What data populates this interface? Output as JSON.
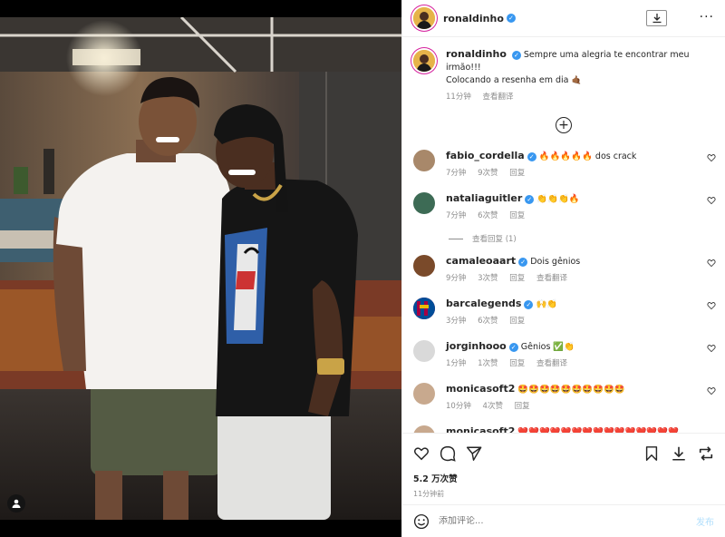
{
  "post": {
    "author": "ronaldinho",
    "caption_line1": "Sempre uma alegria te encontrar meu irmão!!!",
    "caption_line2": "Colocando a resenha em dia",
    "caption_emoji": "🤙🏾",
    "caption_time": "11分钟",
    "see_translation": "查看翻译",
    "likes": "5.2 万次赞",
    "time_ago": "11分钟前"
  },
  "comments": [
    {
      "user": "fabio_cordella",
      "text": "🔥🔥🔥🔥🔥 dos crack",
      "time": "7分钟",
      "likes": "9次赞",
      "reply": "回复",
      "translate": "",
      "avatar_color": "#a8886a"
    },
    {
      "user": "nataliaguitler",
      "text": "👏👏👏🔥",
      "time": "7分钟",
      "likes": "6次赞",
      "reply": "回复",
      "translate": "",
      "avatar_color": "#3d6b55",
      "view_replies": "查看回复 (1)"
    },
    {
      "user": "camaleoaart",
      "text": "Dois gênios",
      "time": "9分钟",
      "likes": "3次赞",
      "reply": "回复",
      "translate": "查看翻译",
      "avatar_color": "#7a4a2a"
    },
    {
      "user": "barcalegends",
      "text": "🙌👏",
      "time": "3分钟",
      "likes": "6次赞",
      "reply": "回复",
      "translate": "",
      "avatar_color": "#a50044"
    },
    {
      "user": "jorginhooo",
      "text": "Gênios ✅👏",
      "time": "1分钟",
      "likes": "1次赞",
      "reply": "回复",
      "translate": "查看翻译",
      "avatar_color": "#d9d9d9"
    },
    {
      "user": "monicasoft2",
      "text": "🤩🤩🤩🤩🤩🤩🤩🤩🤩🤩",
      "time": "10分钟",
      "likes": "4次赞",
      "reply": "回复",
      "translate": "",
      "avatar_color": "#c8a98e"
    },
    {
      "user": "monicasoft2",
      "text": "❤️❤️❤️❤️❤️❤️❤️❤️❤️❤️❤️❤️❤️❤️❤️",
      "time": "",
      "likes": "",
      "reply": "",
      "translate": "",
      "avatar_color": "#c8a98e"
    }
  ],
  "comment_box": {
    "placeholder": "添加评论...",
    "post_label": "发布"
  },
  "colors": {
    "verified": "#3897f0",
    "muted": "#8e8e8e",
    "post_button": "#b2dffc"
  },
  "icons": {
    "like": "heart-icon",
    "comment": "comment-icon",
    "share": "share-icon",
    "save": "bookmark-icon",
    "download": "download-icon",
    "repost": "repost-icon",
    "emoji": "smiley-icon",
    "more": "more-icon",
    "load_more": "plus-circle-icon",
    "tag": "user-tag-icon"
  }
}
